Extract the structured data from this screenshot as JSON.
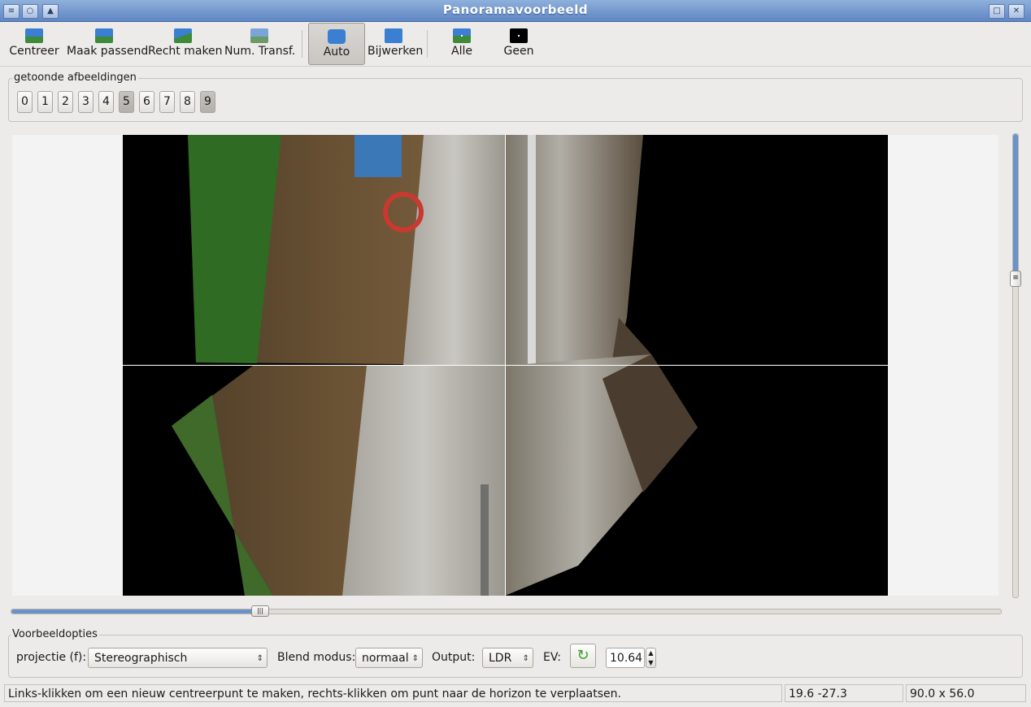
{
  "window": {
    "title": "Panoramavoorbeeld"
  },
  "toolbar": {
    "center_label": "Centreer",
    "fit_label": "Maak passend",
    "straighten_label": "Recht maken",
    "numtransf_label": "Num. Transf.",
    "auto_label": "Auto",
    "update_label": "Bijwerken",
    "all_label": "Alle",
    "none_label": "Geen"
  },
  "images_group": {
    "title": "getoonde afbeeldingen",
    "buttons": [
      "0",
      "1",
      "2",
      "3",
      "4",
      "5",
      "6",
      "7",
      "8",
      "9"
    ],
    "active": [
      5,
      9
    ]
  },
  "options": {
    "title": "Voorbeeldopties",
    "projection_label": "projectie (f):",
    "projection_value": "Stereographisch",
    "blend_label": "Blend modus:",
    "blend_value": "normaal",
    "output_label": "Output:",
    "output_value": "LDR",
    "ev_label": "EV:",
    "ev_value": "10.64"
  },
  "status": {
    "message": "Links-klikken om een nieuw centreerpunt te maken, rechts-klikken om punt naar de horizon te verplaatsen.",
    "coords": "19.6 -27.3",
    "fov": "90.0 x 56.0"
  },
  "colors": {
    "accent": "#6a93c9",
    "titlebar": "#6f93cc"
  }
}
